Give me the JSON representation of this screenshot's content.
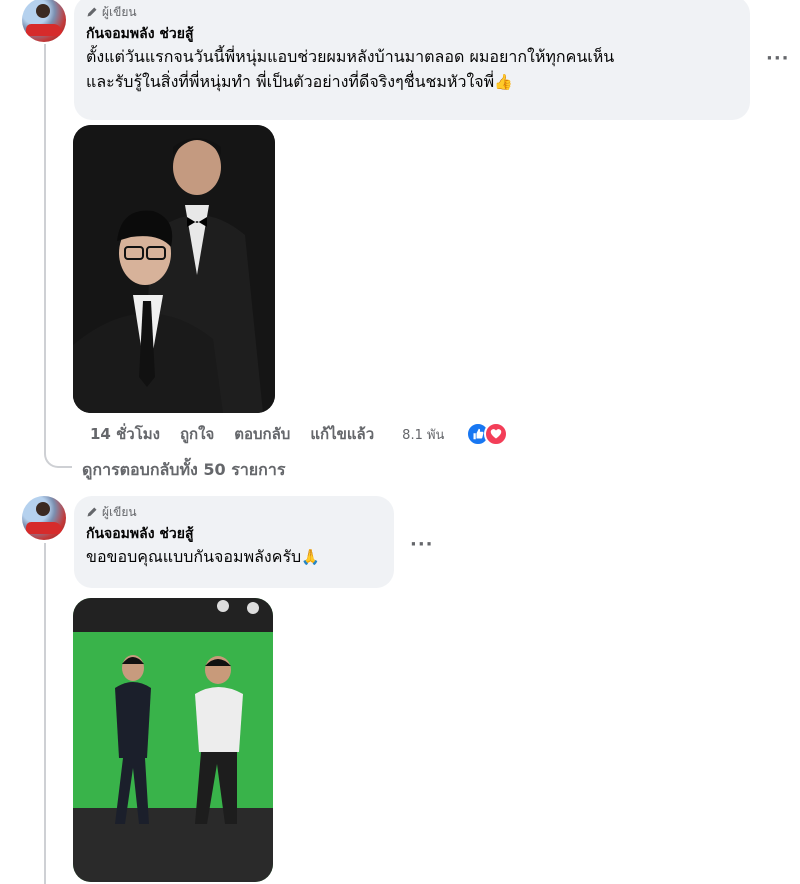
{
  "comments": [
    {
      "badge": "ผู้เขียน",
      "author": "กันจอมพลัง ช่วยสู้",
      "line1": "ตั้งแต่วันแรกจนวันนี้พี่หนุ่มแอบช่วยผมหลังบ้านมาตลอด ผมอยากให้ทุกคนเห็น",
      "line2": "และรับรู้ในสิ่งที่พี่หนุ่มทำ พี่เป็นตัวอย่างที่ดีจริงๆชื่นชมหัวใจพี่",
      "emoji": "👍",
      "more": "···",
      "photo_icon": "two-men-in-suits-photo",
      "actions": {
        "time": "14 ชั่วโมง",
        "like": "ถูกใจ",
        "reply": "ตอบกลับ",
        "edited": "แก้ไขแล้ว",
        "reaction_count": "8.1 พัน",
        "reaction_icons": [
          "like-icon",
          "love-icon"
        ]
      },
      "view_replies": "ดูการตอบกลับทั้ง 50 รายการ"
    },
    {
      "badge": "ผู้เขียน",
      "author": "กันจอมพลัง ช่วยสู้",
      "line1": "ขอขอบคุณแบบกันจอมพลังครับ",
      "emoji": "🙏",
      "more": "···",
      "photo_icon": "two-men-wai-green-screen-photo"
    }
  ],
  "colors": {
    "bubble": "#f0f2f5",
    "secondary_text": "#65676b",
    "like_blue": "#1877f2",
    "love_red": "#f33e58"
  }
}
